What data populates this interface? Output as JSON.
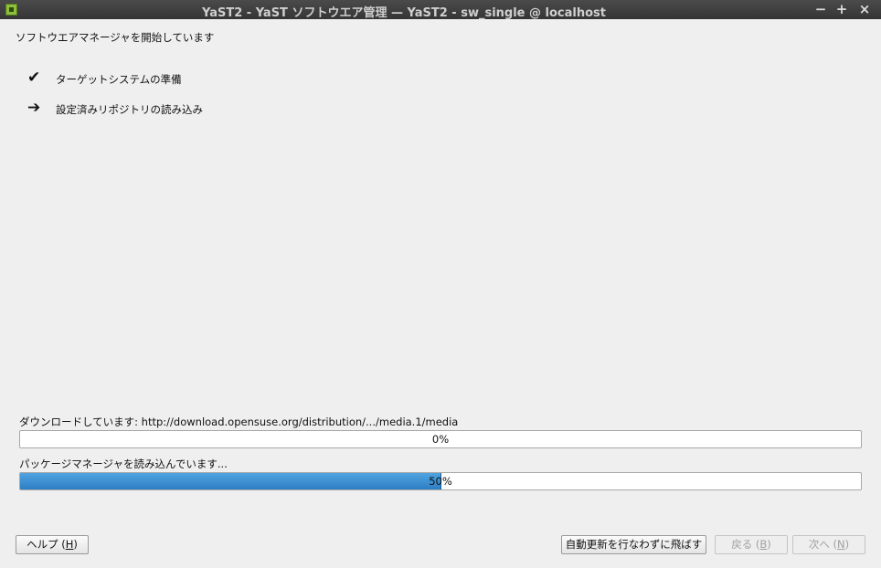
{
  "window": {
    "title": "YaST2 - YaST ソフトウエア管理 — YaST2 - sw_single @ localhost",
    "controls": {
      "minimize": "−",
      "maximize": "+",
      "close": "×"
    }
  },
  "header": {
    "text": "ソフトウエアマネージャを開始しています"
  },
  "steps": [
    {
      "icon": "check-icon",
      "glyph": "✔",
      "label": "ターゲットシステムの準備"
    },
    {
      "icon": "arrow-right-icon",
      "glyph": "➔",
      "label": "設定済みリポジトリの読み込み"
    }
  ],
  "progress": [
    {
      "label": "ダウンロードしています: http://download.opensuse.org/distribution/.../media.1/media",
      "percent": 0,
      "text": "0%"
    },
    {
      "label": "パッケージマネージャを読み込んでいます...",
      "percent": 50,
      "text": "50%"
    }
  ],
  "buttons": {
    "help": {
      "text": "ヘルプ (",
      "mnemonic": "H",
      "close": ")"
    },
    "skip": {
      "text": "自動更新を行なわずに飛ばす"
    },
    "back": {
      "text": "戻る (",
      "mnemonic": "B",
      "close": ")"
    },
    "next": {
      "text": "次へ (",
      "mnemonic": "N",
      "close": ")"
    }
  },
  "colors": {
    "progress_fill": "#2d7fc4",
    "titlebar": "#3f3f3f"
  }
}
